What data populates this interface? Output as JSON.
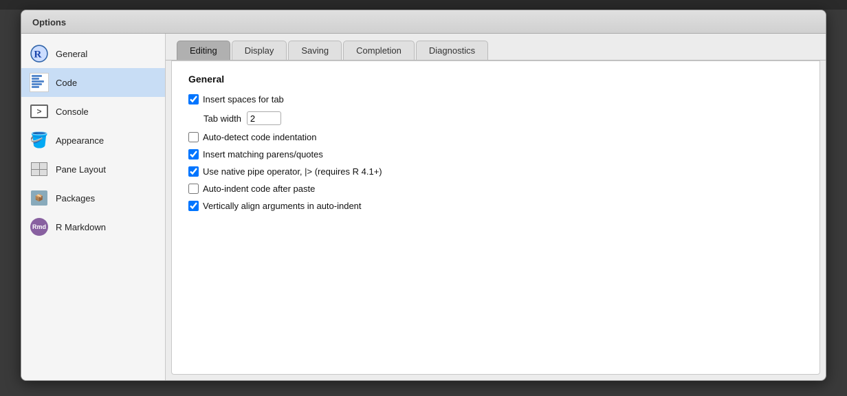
{
  "dialog": {
    "title": "Options"
  },
  "sidebar": {
    "items": [
      {
        "id": "general",
        "label": "General",
        "icon": "r-logo"
      },
      {
        "id": "code",
        "label": "Code",
        "icon": "code-doc",
        "active": true
      },
      {
        "id": "console",
        "label": "Console",
        "icon": "console-arrow"
      },
      {
        "id": "appearance",
        "label": "Appearance",
        "icon": "paint-bucket"
      },
      {
        "id": "pane-layout",
        "label": "Pane Layout",
        "icon": "pane-grid"
      },
      {
        "id": "packages",
        "label": "Packages",
        "icon": "package-box"
      },
      {
        "id": "r-markdown",
        "label": "R Markdown",
        "icon": "rmd-badge"
      }
    ]
  },
  "tabs": [
    {
      "id": "editing",
      "label": "Editing",
      "active": true
    },
    {
      "id": "display",
      "label": "Display",
      "active": false
    },
    {
      "id": "saving",
      "label": "Saving",
      "active": false
    },
    {
      "id": "completion",
      "label": "Completion",
      "active": false
    },
    {
      "id": "diagnostics",
      "label": "Diagnostics",
      "active": false
    }
  ],
  "content": {
    "section_title": "General",
    "options": [
      {
        "id": "insert-spaces-tab",
        "label": "Insert spaces for tab",
        "checked": true
      },
      {
        "id": "auto-detect-indent",
        "label": "Auto-detect code indentation",
        "checked": false
      },
      {
        "id": "insert-matching-parens",
        "label": "Insert matching parens/quotes",
        "checked": true
      },
      {
        "id": "native-pipe",
        "label": "Use native pipe operator, |> (requires R 4.1+)",
        "checked": true
      },
      {
        "id": "auto-indent-paste",
        "label": "Auto-indent code after paste",
        "checked": false
      },
      {
        "id": "vertically-align",
        "label": "Vertically align arguments in auto-indent",
        "checked": true
      }
    ],
    "tab_width_label": "Tab width",
    "tab_width_value": "2"
  }
}
